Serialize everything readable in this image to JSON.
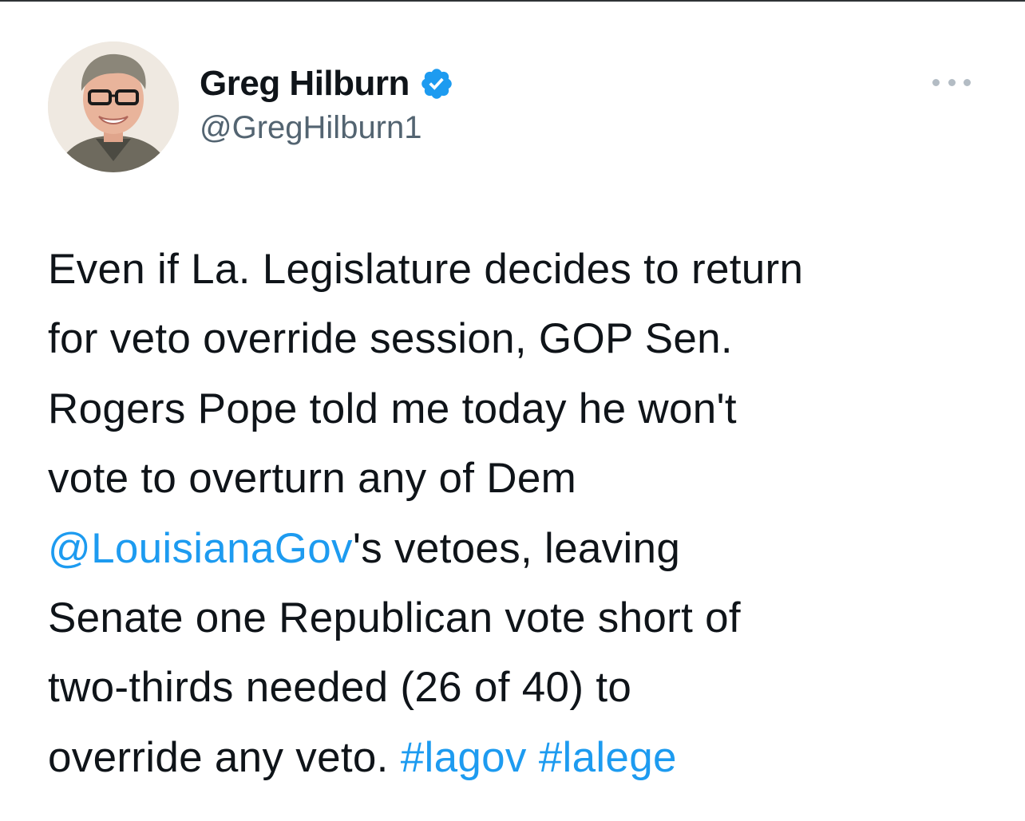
{
  "author": {
    "display_name": "Greg Hilburn",
    "handle": "@GregHilburn1",
    "verified": true,
    "verified_color": "#1d9bf0"
  },
  "menu": {
    "icon": "more-horizontal-icon"
  },
  "tweet": {
    "line1": "Even if La. Legislature decides to return",
    "line2": "for veto override session, GOP Sen.",
    "line3": "Rogers Pope told me today he won't",
    "line4": "vote to overturn any of Dem",
    "mention": "@LouisianaGov",
    "line5_rest": "'s vetoes, leaving",
    "line6": "Senate one Republican vote short of",
    "line7": "two-thirds needed (26 of 40) to",
    "line8_pre": "override any veto. ",
    "hashtag1": "#lagov",
    "hashtag2": "#lalege"
  },
  "colors": {
    "text": "#0f1419",
    "secondary": "#536471",
    "link": "#1d9bf0"
  }
}
